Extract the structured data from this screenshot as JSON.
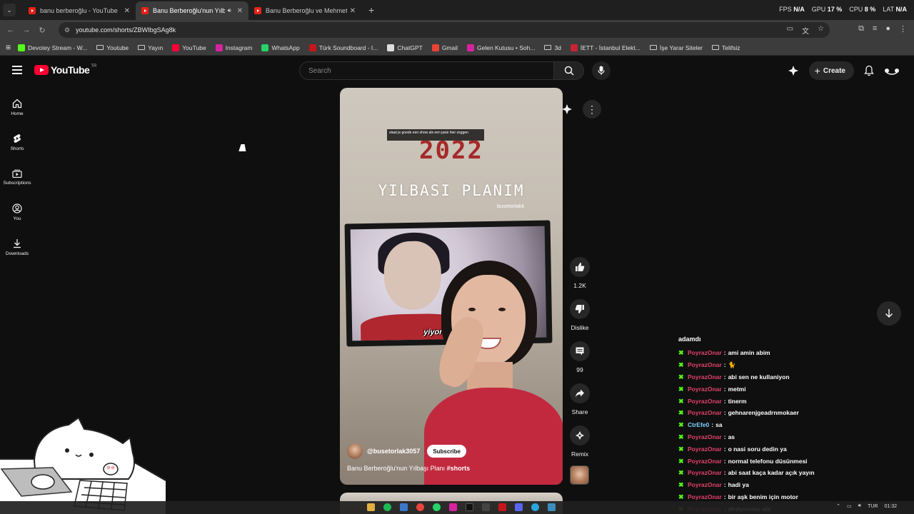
{
  "browser": {
    "tabs": [
      {
        "title": "banu berberoğlu - YouTube",
        "active": false,
        "audio": false
      },
      {
        "title": "Banu Berberoğlu'nun Yılbaşı",
        "active": true,
        "audio": true
      },
      {
        "title": "Banu Berberoğlu ve Mehmet ile",
        "active": false,
        "audio": false
      }
    ],
    "new_tab": "+",
    "stats": [
      {
        "label": "FPS",
        "value": "N/A"
      },
      {
        "label": "GPU",
        "value": "17 %"
      },
      {
        "label": "CPU",
        "value": "8 %"
      },
      {
        "label": "LAT",
        "value": "N/A"
      }
    ],
    "url": "youtube.com/shorts/ZBWIbgSAg8k",
    "bookmarks": [
      {
        "label": "Devotey Stream - W...",
        "icon": "kick-icon",
        "color": "#53fc18"
      },
      {
        "label": "Youtube",
        "icon": "folder-icon",
        "color": ""
      },
      {
        "label": "Yayın",
        "icon": "folder-icon",
        "color": ""
      },
      {
        "label": "YouTube",
        "icon": "youtube-icon",
        "color": "#ff0033"
      },
      {
        "label": "Instagram",
        "icon": "instagram-icon",
        "color": "#d6249f"
      },
      {
        "label": "WhatsApp",
        "icon": "whatsapp-icon",
        "color": "#25d366"
      },
      {
        "label": "Türk Soundboard - I...",
        "icon": "soundboard-icon",
        "color": "#c4161c"
      },
      {
        "label": "ChatGPT",
        "icon": "chatgpt-icon",
        "color": "#dddddd"
      },
      {
        "label": "Gmail",
        "icon": "gmail-icon",
        "color": "#ea4335"
      },
      {
        "label": "Gelen Kutusu • Soh...",
        "icon": "instagram-icon",
        "color": "#d6249f"
      },
      {
        "label": "3d",
        "icon": "folder-icon",
        "color": ""
      },
      {
        "label": "İETT - İstanbul Elekt...",
        "icon": "iett-icon",
        "color": "#c82333"
      },
      {
        "label": "İşe Yarar Siteler",
        "icon": "folder-icon",
        "color": ""
      },
      {
        "label": "Telifsiz",
        "icon": "folder-icon",
        "color": ""
      }
    ]
  },
  "youtube": {
    "logo_text": "YouTube",
    "country": "TR",
    "search_placeholder": "Search",
    "create_label": "Create",
    "nav": [
      {
        "label": "Home",
        "icon": "home-icon"
      },
      {
        "label": "Shorts",
        "icon": "shorts-icon"
      },
      {
        "label": "Subscriptions",
        "icon": "subscriptions-icon"
      },
      {
        "label": "You",
        "icon": "you-icon"
      },
      {
        "label": "Downloads",
        "icon": "downloads-icon"
      }
    ],
    "short": {
      "overlay_caption": "staat je goede een show als een jasie hier zeggen",
      "year_text": "2022",
      "plan_text": "YILBASI PLANIM",
      "watermark": "busetorlakk",
      "tv_subtitle": "yiyoruz ç",
      "channel": "@busetorlak3057",
      "subscribe_label": "Subscribe",
      "title": "Banu Berberoğlu'nun Yılbaşı Planı",
      "hashtag": "#shorts"
    },
    "actions": [
      {
        "name": "like",
        "label": "1.2K",
        "icon": "thumbs-up-icon"
      },
      {
        "name": "dislike",
        "label": "Dislike",
        "icon": "thumbs-down-icon"
      },
      {
        "name": "comments",
        "label": "99",
        "icon": "comment-icon"
      },
      {
        "name": "share",
        "label": "Share",
        "icon": "share-icon"
      },
      {
        "name": "remix",
        "label": "Remix",
        "icon": "remix-icon"
      }
    ]
  },
  "chat": {
    "header": "adamdı",
    "messages": [
      {
        "user": "PoyrazOnar",
        "text": "ami amin abim",
        "user_color": "#e0416a"
      },
      {
        "user": "PoyrazOnar",
        "text": "🐈",
        "user_color": "#e0416a"
      },
      {
        "user": "PoyrazOnar",
        "text": "abi sen ne kullaniyon",
        "user_color": "#e0416a"
      },
      {
        "user": "PoyrazOnar",
        "text": "metmi",
        "user_color": "#e0416a"
      },
      {
        "user": "PoyrazOnar",
        "text": "tinerm",
        "user_color": "#e0416a"
      },
      {
        "user": "PoyrazOnar",
        "text": "gehnarenjgeadrnmokaer",
        "user_color": "#e0416a"
      },
      {
        "user": "CtrEfe0",
        "text": "sa",
        "user_color": "#7fd2ff"
      },
      {
        "user": "PoyrazOnar",
        "text": "as",
        "user_color": "#e0416a"
      },
      {
        "user": "PoyrazOnar",
        "text": "o nasi soru dedin ya",
        "user_color": "#e0416a"
      },
      {
        "user": "PoyrazOnar",
        "text": "normal telefonu düsünmesi",
        "user_color": "#e0416a"
      },
      {
        "user": "PoyrazOnar",
        "text": "abi saat kaça kadar açık yayın",
        "user_color": "#e0416a"
      },
      {
        "user": "PoyrazOnar",
        "text": "hadi ya",
        "user_color": "#e0416a"
      },
      {
        "user": "PoyrazOnar",
        "text": "bir aşk benim için motor",
        "user_color": "#e0416a"
      },
      {
        "user": "PoyrazOnar",
        "text": "dinliyonmu abi",
        "user_color": "#e0416a"
      }
    ]
  },
  "taskbar": {
    "language": "TUR",
    "time": "01:32"
  }
}
